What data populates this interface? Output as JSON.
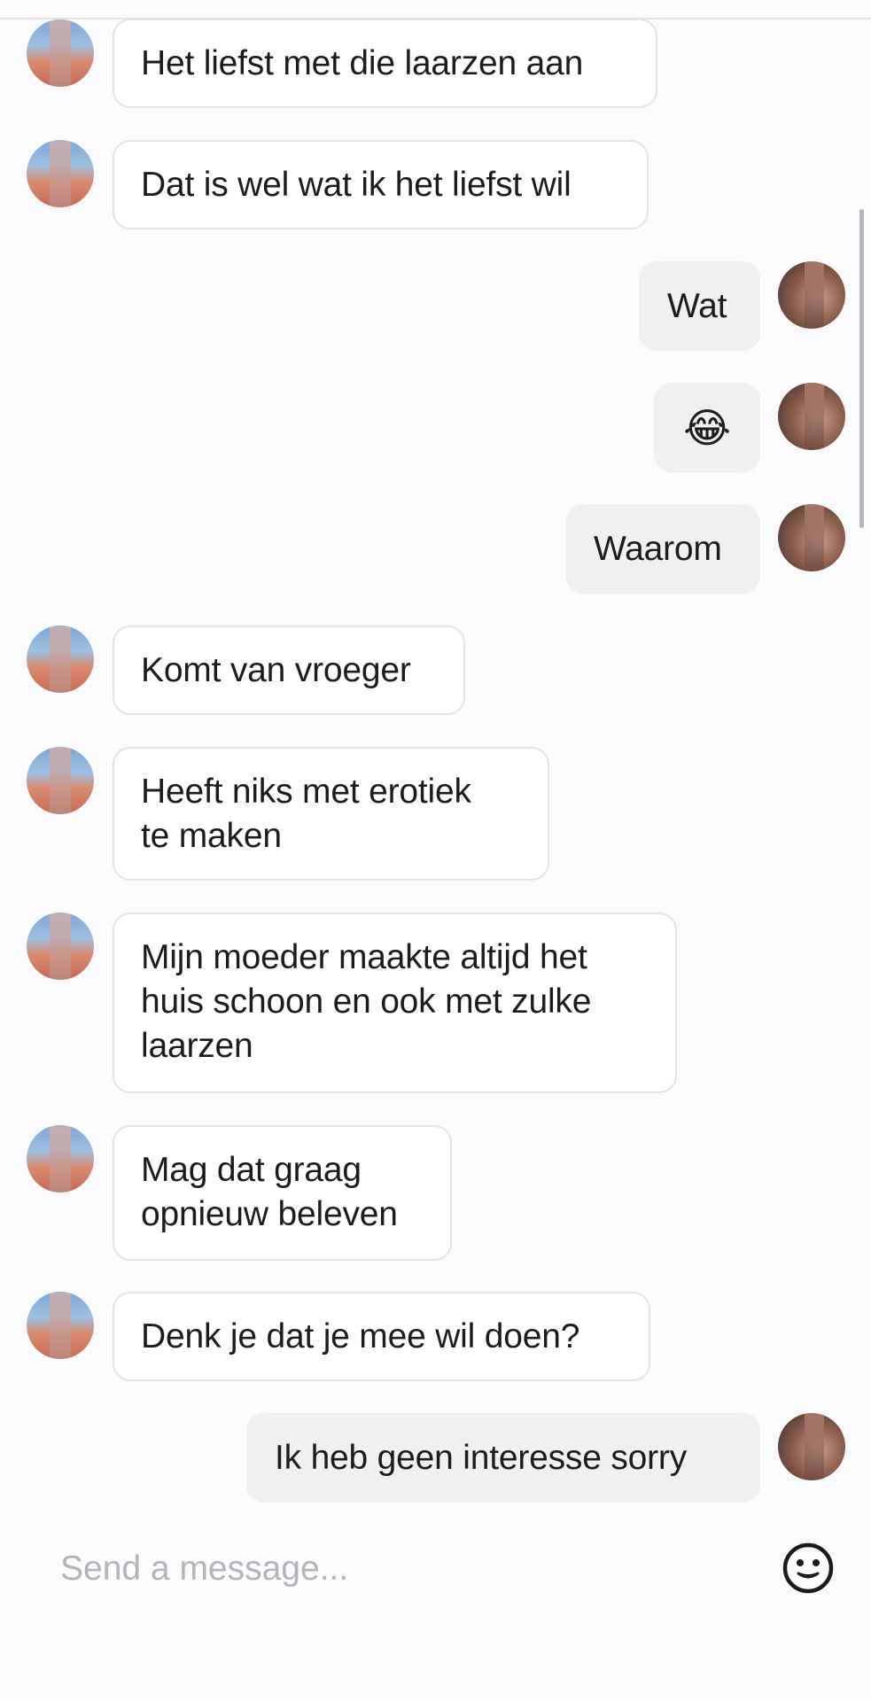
{
  "messages": [
    {
      "side": "in",
      "text": "Het liefst met die laarzen aan"
    },
    {
      "side": "in",
      "text": "Dat is wel wat ik het liefst wil"
    },
    {
      "side": "out",
      "text": "Wat"
    },
    {
      "side": "out",
      "text": "😂"
    },
    {
      "side": "out",
      "text": "Waarom"
    },
    {
      "side": "in",
      "text": "Komt van vroeger"
    },
    {
      "side": "in",
      "text": "Heeft niks met erotiek\nte maken"
    },
    {
      "side": "in",
      "text": "Mijn moeder maakte altijd het\nhuis schoon en ook met zulke\nlaarzen"
    },
    {
      "side": "in",
      "text": "Mag dat graag\nopnieuw beleven"
    },
    {
      "side": "in",
      "text": "Denk je dat je mee wil doen?"
    },
    {
      "side": "out",
      "text": "Ik heb geen interesse sorry"
    }
  ],
  "composer": {
    "placeholder": "Send a message...",
    "emoji_icon": "smiley-face-icon"
  },
  "colors": {
    "incoming_bubble": "#ffffff",
    "incoming_border": "#e3e3e7",
    "outgoing_bubble": "#f0f0f2",
    "placeholder": "#b3b3b8"
  }
}
